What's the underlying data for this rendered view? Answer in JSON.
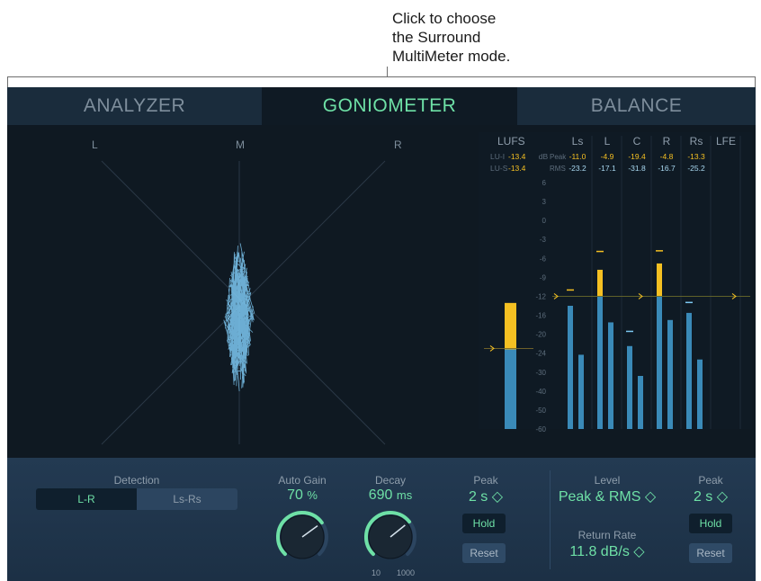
{
  "callout": {
    "lines": [
      "Click to choose",
      "the Surround",
      "MultiMeter mode."
    ]
  },
  "tabs": [
    {
      "label": "ANALYZER",
      "active": false
    },
    {
      "label": "GONIOMETER",
      "active": true
    },
    {
      "label": "BALANCE",
      "active": false
    }
  ],
  "goniometer": {
    "labels": {
      "left": "L",
      "mid": "M",
      "right": "R"
    }
  },
  "meters": {
    "lufs": {
      "title": "LUFS",
      "lu_i_label": "LU-I",
      "lu_i_value": "-13.4",
      "lu_s_label": "LU-S",
      "lu_s_value": "-13.4",
      "bar": {
        "rms": -23.2,
        "peak": -13.4
      }
    },
    "unit": "dB",
    "scale": [
      "6",
      "3",
      "0",
      "-3",
      "-6",
      "-9",
      "-12",
      "-16",
      "-20",
      "-24",
      "-30",
      "-40",
      "-50",
      "-60"
    ],
    "row_labels": {
      "peak": "Peak",
      "rms": "RMS"
    },
    "channels": [
      {
        "name": "Ls",
        "peak": "-11.0",
        "rms": "-23.2",
        "peak_db": -14.0,
        "rms_db": -24.5,
        "hold_db": -11.0,
        "peak_color": "blue"
      },
      {
        "name": "L",
        "peak": "-4.9",
        "rms": "-17.1",
        "peak_db": -7.8,
        "rms_db": -17.5,
        "hold_db": -4.9,
        "peak_color": "yellow"
      },
      {
        "name": "C",
        "peak": "-19.4",
        "rms": "-31.8",
        "peak_db": -22.5,
        "rms_db": -32.0,
        "hold_db": -19.4,
        "peak_color": "blue"
      },
      {
        "name": "R",
        "peak": "-4.8",
        "rms": "-16.7",
        "peak_db": -6.8,
        "rms_db": -17.0,
        "hold_db": -4.8,
        "peak_color": "yellow"
      },
      {
        "name": "Rs",
        "peak": "-13.3",
        "rms": "-25.2",
        "peak_db": -15.5,
        "rms_db": -26.0,
        "hold_db": -13.3,
        "peak_color": "blue"
      },
      {
        "name": "LFE",
        "peak": "",
        "rms": "",
        "peak_db": null,
        "rms_db": null,
        "hold_db": null,
        "peak_color": "blue"
      }
    ],
    "target_db": -12,
    "lufs_target_db": -23,
    "colors": {
      "rms": "#3a8ab8",
      "yellow": "#f5c022",
      "peak_text": "#f5c022",
      "rms_text": "#a9d8f0"
    }
  },
  "controls": {
    "detection": {
      "label": "Detection",
      "options": [
        "L-R",
        "Ls-Rs"
      ],
      "selected": "L-R"
    },
    "auto_gain": {
      "label": "Auto Gain",
      "value": "70",
      "unit": "%",
      "level": 0.7
    },
    "decay": {
      "label": "Decay",
      "value": "690",
      "unit": "ms",
      "min": "10",
      "max": "1000",
      "level": 0.69
    },
    "peak_left": {
      "label": "Peak",
      "value": "2 s ◇",
      "hold": "Hold",
      "reset": "Reset"
    },
    "level": {
      "label": "Level",
      "value": "Peak & RMS ◇"
    },
    "return_rate": {
      "label": "Return Rate",
      "value": "11.8 dB/s ◇"
    },
    "peak_right": {
      "label": "Peak",
      "value": "2 s ◇",
      "hold": "Hold",
      "reset": "Reset"
    }
  }
}
